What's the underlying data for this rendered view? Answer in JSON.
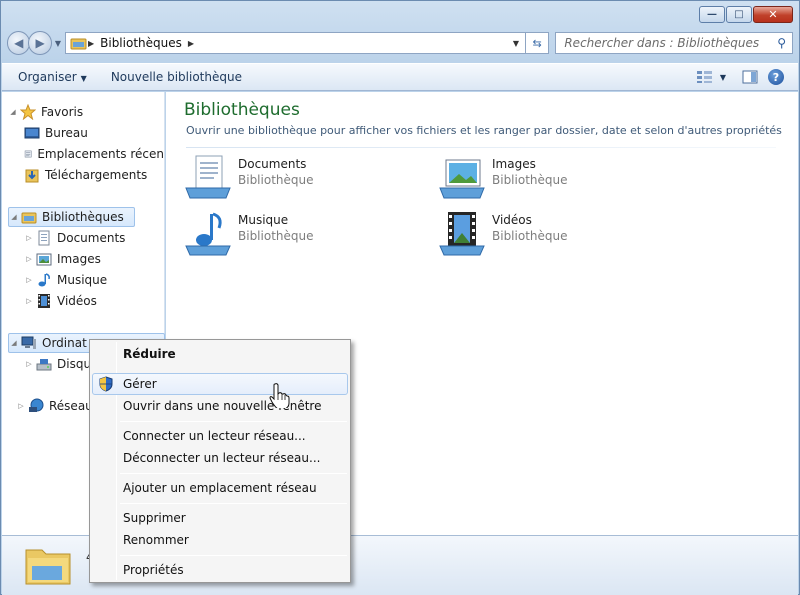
{
  "window": {
    "caption": {
      "minimize_glyph": "—",
      "maximize_glyph": "□",
      "close_glyph": "✕"
    }
  },
  "navbar": {
    "breadcrumb": [
      "Bibliothèques"
    ],
    "search_placeholder": "Rechercher dans : Bibliothèques"
  },
  "toolbar": {
    "organize_label": "Organiser",
    "new_library_label": "Nouvelle bibliothèque",
    "help_label": "?"
  },
  "sidebar": {
    "favorites": {
      "label": "Favoris",
      "items": [
        {
          "label": "Bureau",
          "icon": "desktop-icon"
        },
        {
          "label": "Emplacements récen",
          "icon": "recent-places-icon"
        },
        {
          "label": "Téléchargements",
          "icon": "downloads-icon"
        }
      ]
    },
    "libraries": {
      "label": "Bibliothèques",
      "items": [
        {
          "label": "Documents",
          "icon": "documents-icon"
        },
        {
          "label": "Images",
          "icon": "pictures-icon"
        },
        {
          "label": "Musique",
          "icon": "music-icon"
        },
        {
          "label": "Vidéos",
          "icon": "videos-icon"
        }
      ]
    },
    "computer": {
      "label": "Ordinat",
      "items": [
        {
          "label": "Disqu",
          "icon": "local-disk-icon"
        }
      ]
    },
    "network": {
      "label": "Réseau"
    }
  },
  "main": {
    "title": "Bibliothèques",
    "description": "Ouvrir une bibliothèque pour afficher vos fichiers et les ranger par dossier, date et selon d'autres propriétés",
    "libraries": [
      {
        "name": "Documents",
        "kind": "Bibliothèque",
        "icon": "documents-library-icon"
      },
      {
        "name": "Images",
        "kind": "Bibliothèque",
        "icon": "pictures-library-icon"
      },
      {
        "name": "Musique",
        "kind": "Bibliothèque",
        "icon": "music-library-icon"
      },
      {
        "name": "Vidéos",
        "kind": "Bibliothèque",
        "icon": "videos-library-icon"
      }
    ]
  },
  "details": {
    "count": "4"
  },
  "context_menu": {
    "items": [
      {
        "label": "Réduire"
      },
      {
        "label": "Gérer"
      },
      {
        "label": "Ouvrir dans une nouvelle fenêtre"
      },
      {
        "label": "Connecter un lecteur réseau..."
      },
      {
        "label": "Déconnecter un lecteur réseau..."
      },
      {
        "label": "Ajouter un emplacement réseau"
      },
      {
        "label": "Supprimer"
      },
      {
        "label": "Renommer"
      },
      {
        "label": "Propriétés"
      }
    ]
  },
  "colors": {
    "accent_title": "#1e6c2e",
    "selection": "#d6e8fc",
    "window_frame": "#bcd3ea"
  }
}
